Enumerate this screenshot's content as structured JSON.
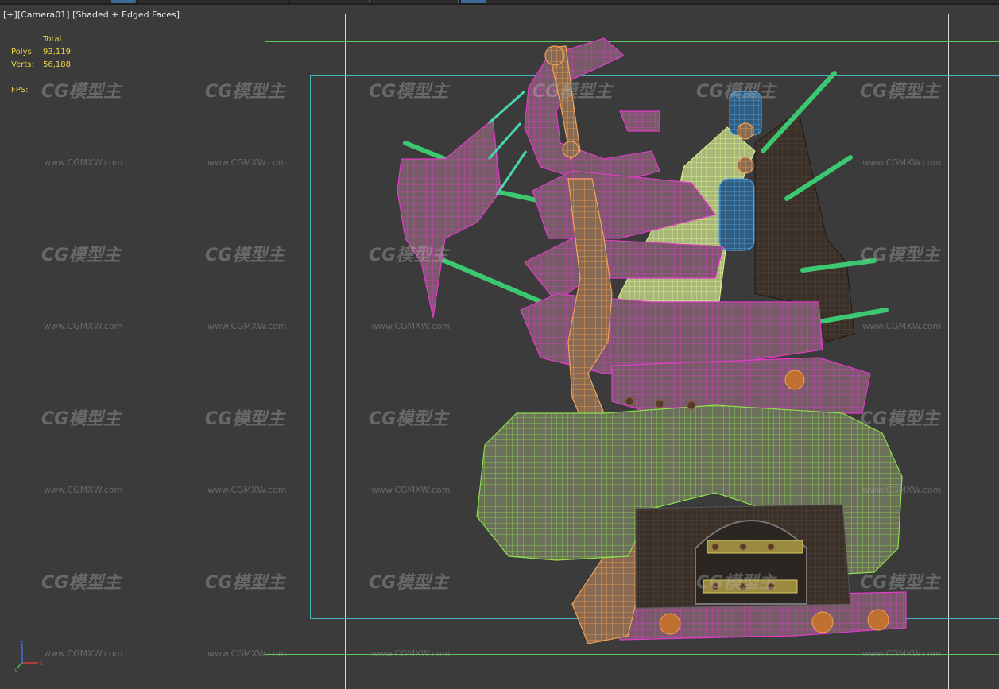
{
  "viewport": {
    "label_parts": [
      "[+]",
      "[Camera01]",
      "[Shaded + Edged Faces]"
    ]
  },
  "stats": {
    "total_label": "Total",
    "polys_label": "Polys:",
    "polys_value": "93,119",
    "verts_label": "Verts:",
    "verts_value": "56,188",
    "fps_label": "FPS:"
  },
  "watermark": {
    "logo_text": "CG模型主",
    "url_text": "www.CGMXW.com"
  },
  "axis": {
    "x_label": "x",
    "y_label": "y",
    "z_label": "z"
  },
  "colors": {
    "background": "#3b3b3b",
    "stats_text": "#e8d24a",
    "safe_frame_green": "#5cc85c",
    "safe_frame_cyan": "#49b4c4",
    "render_frame_white": "#d8d8d8",
    "wire_magenta": "#e03cc8",
    "wire_orange": "#f2a25a",
    "wire_green": "#8ee04a",
    "wire_teal": "#48d8b0",
    "wire_blue": "#3e90d0"
  }
}
